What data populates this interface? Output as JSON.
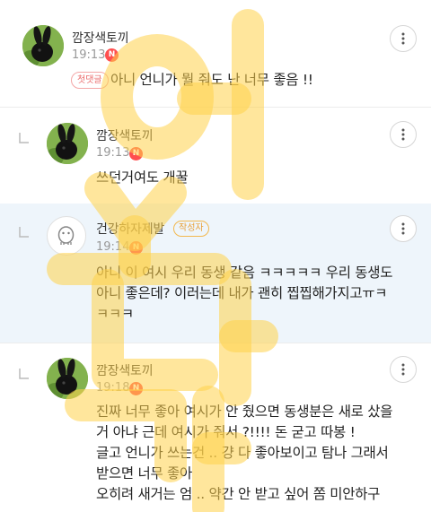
{
  "comments": [
    {
      "author": "깜장색토끼",
      "time": "19:13",
      "new_badge": "N",
      "first_badge": "첫댓글",
      "lines": [
        "아니 언니가 뭘 줘도 난 너무 좋음 !!"
      ]
    },
    {
      "author": "깜장색토끼",
      "time": "19:13",
      "new_badge": "N",
      "lines": [
        "쓰던거여도 개꿀"
      ]
    },
    {
      "author": "건강하자제발",
      "time": "19:14",
      "new_badge": "N",
      "writer_badge": "작성자",
      "lines": [
        "아니 이 여시 우리 동생 같음 ㅋㅋㅋㅋㅋ 우리 동생도",
        "아니 좋은데? 이러는데 내가 괜히 찝찝해가지고ㅠㅋ",
        "ㅋㅋㅋ"
      ]
    },
    {
      "author": "깜장색토끼",
      "time": "19:18",
      "new_badge": "N",
      "lines": [
        "진짜 너무 좋아 여시가 안 줬으면 동생분은 새로 샀을",
        "거 아냐 근데 여시가 줘서 ?!!!! 돈 굳고 따봉 !",
        "글고 언니가 쓰는건 .. 걍 다 좋아보이고 탐나 그래서",
        "받으면 너무 좋아",
        "오히려 새거는 엄 .. 약간 안 받고 싶어 쫌 미안하구"
      ]
    }
  ],
  "icons": {
    "more": "more-vertical-icon",
    "reply": "reply-arrow-icon",
    "avatar_rabbit": "black-rabbit-avatar",
    "avatar_default": "default-profile-avatar"
  },
  "colors": {
    "writer_row_bg": "#eef5fb",
    "new_badge": "#ff4f4f",
    "writer_badge": "#e8a13a",
    "first_badge": "#ea6a6a",
    "watermark": "#ffd24a"
  }
}
